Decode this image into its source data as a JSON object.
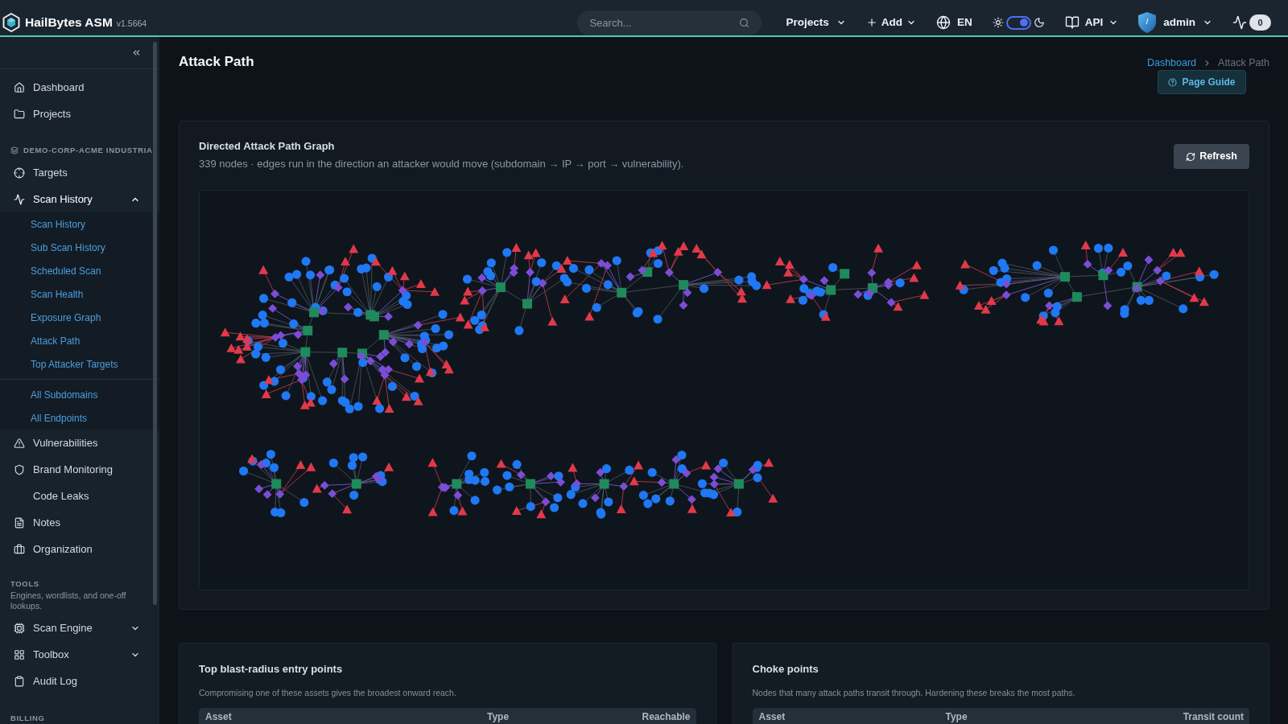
{
  "topbar": {
    "brand": "HailBytes ASM",
    "version": "v1.5664",
    "search": {
      "placeholder": "Search..."
    },
    "actions": [
      {
        "kind": "menu",
        "label": "Projects"
      },
      {
        "kind": "add",
        "label": "Add"
      },
      {
        "kind": "language",
        "label": "EN"
      },
      {
        "kind": "theme",
        "on": true
      },
      {
        "kind": "docs",
        "label": "API"
      },
      {
        "kind": "user",
        "label": "admin"
      },
      {
        "kind": "activity",
        "count": "0"
      }
    ]
  },
  "sidebar": {
    "items": [
      {
        "kind": "item",
        "label": "Dashboard"
      },
      {
        "kind": "item",
        "label": "Projects"
      },
      {
        "kind": "section",
        "label": "DEMO-CORP-ACME INDUSTRIA"
      },
      {
        "kind": "item",
        "label": "Targets"
      },
      {
        "kind": "item",
        "label": "Scan History",
        "expanded": true,
        "child_groups": [
          [
            {
              "label": "Scan History"
            },
            {
              "label": "Sub Scan History"
            },
            {
              "label": "Scheduled Scan"
            },
            {
              "label": "Scan Health"
            },
            {
              "label": "Exposure Graph"
            },
            {
              "label": "Attack Path"
            },
            {
              "label": "Top Attacker Targets"
            }
          ],
          [
            {
              "label": "All Subdomains"
            },
            {
              "label": "All Endpoints"
            }
          ]
        ]
      },
      {
        "kind": "item",
        "label": "Vulnerabilities"
      },
      {
        "kind": "item",
        "label": "Brand Monitoring"
      },
      {
        "kind": "item",
        "label": "Code Leaks"
      },
      {
        "kind": "item",
        "label": "Notes"
      },
      {
        "kind": "item",
        "label": "Organization"
      },
      {
        "kind": "section",
        "label": "TOOLS"
      },
      {
        "kind": "note",
        "label": "Engines, wordlists, and one-off lookups."
      },
      {
        "kind": "item",
        "label": "Scan Engine",
        "expanded": false
      },
      {
        "kind": "item",
        "label": "Toolbox",
        "expanded": false
      },
      {
        "kind": "item",
        "label": "Audit Log"
      },
      {
        "kind": "section",
        "label": "BILLING"
      }
    ]
  },
  "page": {
    "title": "Attack Path",
    "breadcrumb": [
      {
        "kind": "link",
        "label": "Dashboard"
      },
      {
        "kind": "current",
        "label": "Attack Path"
      }
    ],
    "guide_button": "Page Guide"
  },
  "graph_card": {
    "title": "Directed Attack Path Graph",
    "subtitle": "339 nodes · edges run in the direction an attacker would move (subdomain → IP → port → vulnerability).",
    "refresh_button": "Refresh"
  },
  "tables": [
    {
      "title": "Top blast-radius entry points",
      "description": "Compromising one of these assets gives the broadest onward reach.",
      "columns": [
        "Asset",
        "Type",
        "Reachable"
      ]
    },
    {
      "title": "Choke points",
      "description": "Nodes that many attack paths transit through. Hardening these breaks the most paths.",
      "columns": [
        "Asset",
        "Type",
        "Transit count"
      ]
    }
  ]
}
